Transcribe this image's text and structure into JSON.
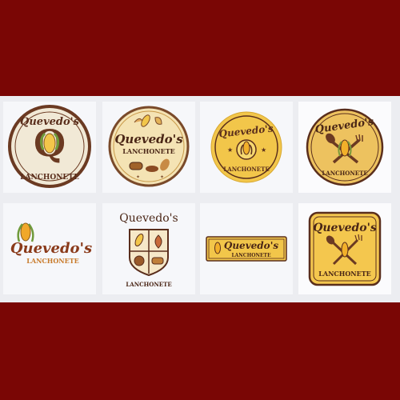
{
  "colors": {
    "frame": "#7a0605",
    "panel": "#ecedf1",
    "tile": "#f6f7fa",
    "brown": "#5a2e1c",
    "gold": "#f2c64a",
    "orange": "#d98a2b",
    "cream": "#f1e9d6"
  },
  "logos": [
    {
      "brand": "Quevedo's",
      "sub": "LANCHONETE",
      "style": "round badge with Q and corn"
    },
    {
      "brand": "Quevedo's",
      "sub": "LANCHONETE",
      "style": "round cream badge with food icons"
    },
    {
      "brand": "Quevedo's",
      "sub": "LANCHONETE",
      "style": "yellow circle with corn"
    },
    {
      "brand": "Quevedo's",
      "sub": "LANCHONETE",
      "style": "yellow circle with spoon, corn and fork"
    },
    {
      "brand": "Quevedo's",
      "sub": "LANCHONETE",
      "style": "corn wordmark"
    },
    {
      "brand": "Quevedo's",
      "sub": "LANCHONETE",
      "style": "shield crest"
    },
    {
      "brand": "Quevedo's",
      "sub": "LANCHONETE",
      "style": "yellow banner"
    },
    {
      "brand": "Quevedo's",
      "sub": "LANCHONETE",
      "style": "yellow square badge with cutlery"
    }
  ]
}
